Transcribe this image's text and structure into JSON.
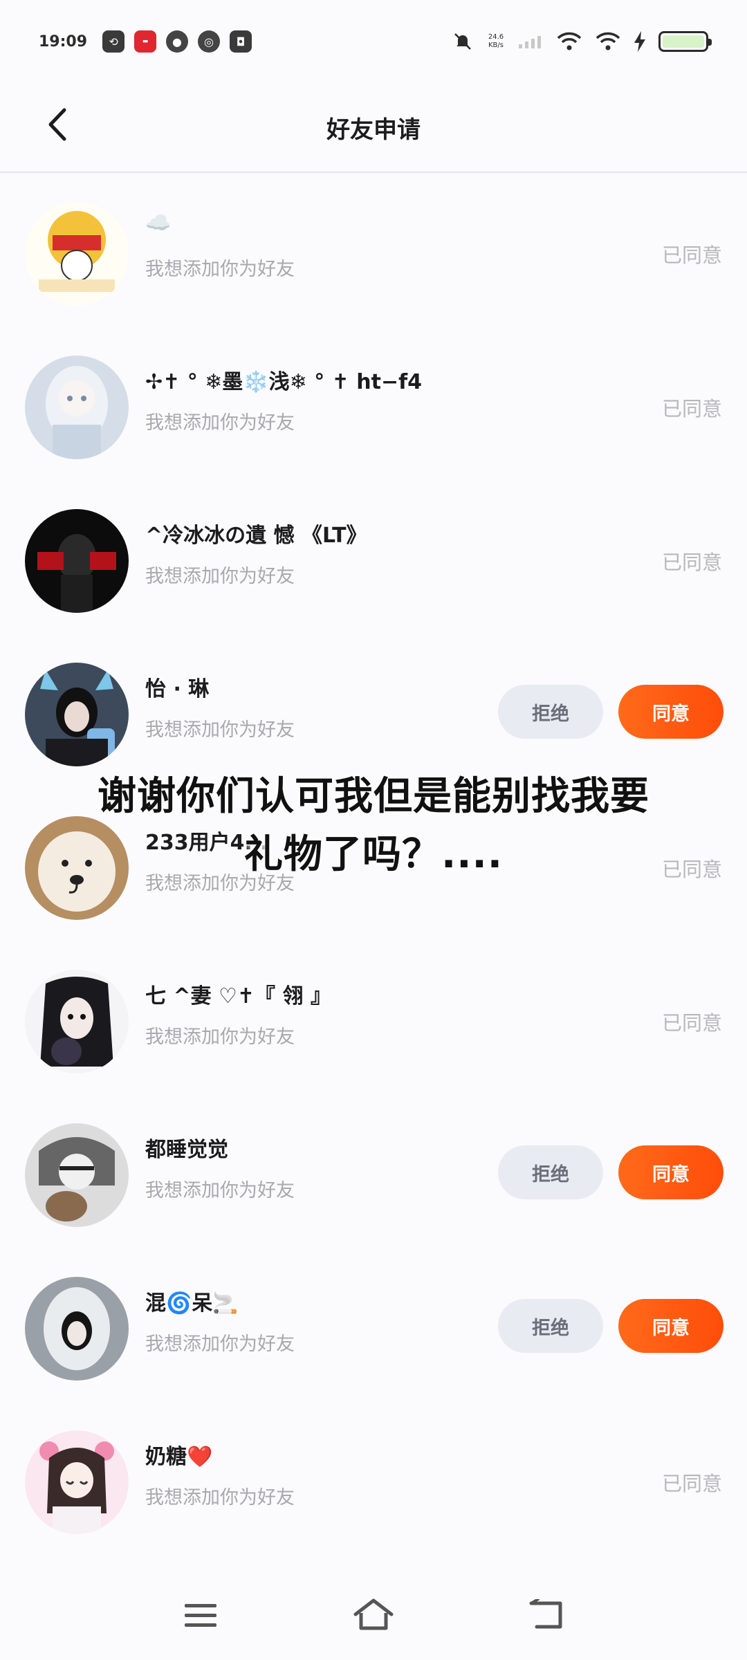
{
  "status_bar": {
    "time": "19:09",
    "net_speed_value": "24.6",
    "net_speed_unit": "KB/s",
    "notification_icons": [
      "sync-icon",
      "xiaohongshu-icon",
      "wechat-icon",
      "netease-music-icon",
      "shopping-bag-icon"
    ],
    "system_icons": [
      "mute-icon",
      "signal-icon",
      "wifi-icon",
      "wifi-icon",
      "charging-icon",
      "battery-icon"
    ]
  },
  "header": {
    "title": "好友申请",
    "back_icon": "chevron-left-icon"
  },
  "requests": [
    {
      "name": "☁️",
      "subtitle": "我想添加你为好友",
      "status": "已同意",
      "pending": false,
      "avatar_color": "#f3c23a"
    },
    {
      "name": "✢✝ ° ❄墨❄️浅❄ ° ✝  ht−f4",
      "subtitle": "我想添加你为好友",
      "status": "已同意",
      "pending": false,
      "avatar_color": "#b9c6d8"
    },
    {
      "name": "^冷冰冰の遺 憾 《LT》",
      "subtitle": "我想添加你为好友",
      "status": "已同意",
      "pending": false,
      "avatar_color": "#101010"
    },
    {
      "name": "怡 · 琳",
      "subtitle": "我想添加你为好友",
      "status": "",
      "pending": true,
      "avatar_color": "#4a6d99"
    },
    {
      "name": "233用户4...",
      "subtitle": "我想添加你为好友",
      "status": "已同意",
      "pending": false,
      "avatar_color": "#c7a47a"
    },
    {
      "name": "七 ^妻 ♡✝『 翎 』",
      "subtitle": "我想添加你为好友",
      "status": "已同意",
      "pending": false,
      "avatar_color": "#2a2a30"
    },
    {
      "name": "都睡觉觉",
      "subtitle": "我想添加你为好友",
      "status": "",
      "pending": true,
      "avatar_color": "#8a8a8a"
    },
    {
      "name": "混🌀呆🚬",
      "subtitle": "我想添加你为好友",
      "status": "",
      "pending": true,
      "avatar_color": "#6b7078"
    },
    {
      "name": "奶糖❤️",
      "subtitle": "我想添加你为好友",
      "status": "已同意",
      "pending": false,
      "avatar_color": "#f2c9d8"
    }
  ],
  "actions": {
    "reject_label": "拒绝",
    "accept_label": "同意"
  },
  "overlay_caption": {
    "line1": "谢谢你们认可我但是能别找我要",
    "line2": "礼物了吗？...."
  },
  "nav": {
    "items": [
      "menu-icon",
      "home-icon",
      "back-icon"
    ]
  }
}
